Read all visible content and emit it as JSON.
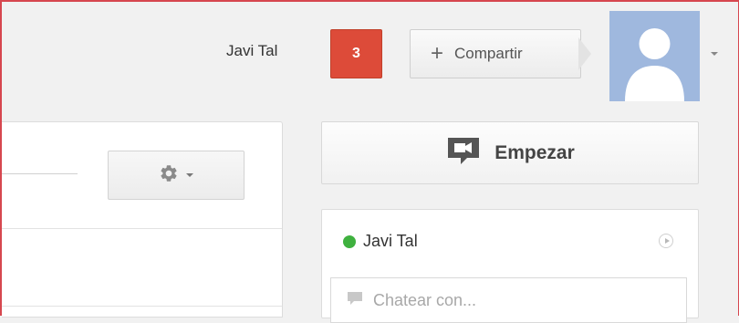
{
  "header": {
    "user_name": "Javi Tal",
    "notification_count": "3",
    "share_label": "Compartir",
    "share_icon": "plus-icon"
  },
  "left_panel": {
    "settings_icon": "gear-icon"
  },
  "hangout": {
    "start_label": "Empezar",
    "start_icon": "video-camera-icon"
  },
  "chat": {
    "user_name": "Javi Tal",
    "status": "online",
    "input_placeholder": "Chatear con..."
  },
  "colors": {
    "notification_bg": "#dd4b39",
    "online_status": "#3fb13f",
    "avatar_bg": "#9fb8de",
    "frame_border": "#d6474f"
  }
}
